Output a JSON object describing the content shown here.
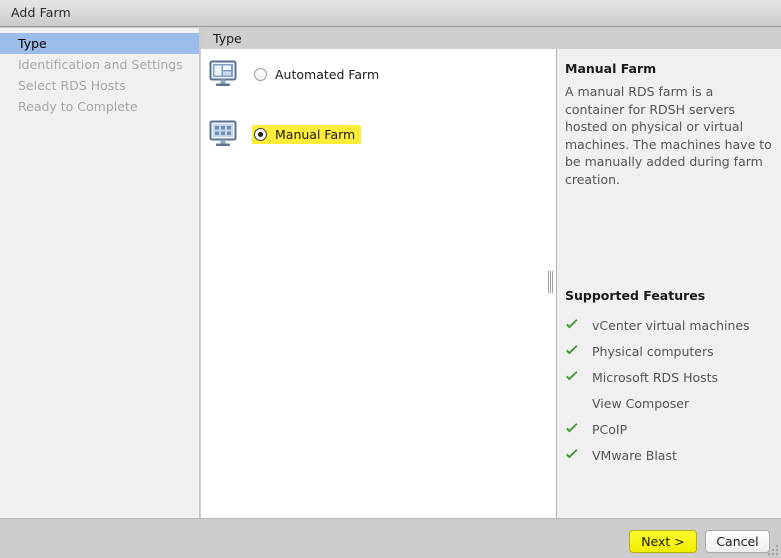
{
  "window": {
    "title": "Add Farm"
  },
  "sidebar": {
    "steps": [
      {
        "label": "Type",
        "state": "active"
      },
      {
        "label": "Identification and Settings",
        "state": "disabled"
      },
      {
        "label": "Select RDS Hosts",
        "state": "disabled"
      },
      {
        "label": "Ready to Complete",
        "state": "disabled"
      }
    ]
  },
  "section": {
    "header": "Type"
  },
  "options": [
    {
      "label": "Automated Farm",
      "icon": "monitor-panes-icon",
      "selected": false,
      "highlighted": false
    },
    {
      "label": "Manual Farm",
      "icon": "monitor-grid-icon",
      "selected": true,
      "highlighted": true
    }
  ],
  "info": {
    "title": "Manual Farm",
    "description": "A manual RDS farm is a container for RDSH servers hosted on physical or virtual machines. The machines have to be manually added during farm creation.",
    "features_title": "Supported Features",
    "features": [
      {
        "label": "vCenter virtual machines",
        "supported": true
      },
      {
        "label": "Physical computers",
        "supported": true
      },
      {
        "label": "Microsoft RDS Hosts",
        "supported": true
      },
      {
        "label": "View Composer",
        "supported": false
      },
      {
        "label": "PCoIP",
        "supported": true
      },
      {
        "label": "VMware Blast",
        "supported": true
      }
    ]
  },
  "footer": {
    "next_label": "Next >",
    "cancel_label": "Cancel"
  },
  "colors": {
    "highlight_yellow": "#ffed3a",
    "next_button_yellow": "#f2ee00",
    "active_step_blue": "#9cbce9",
    "check_green": "#3f9a2f"
  }
}
